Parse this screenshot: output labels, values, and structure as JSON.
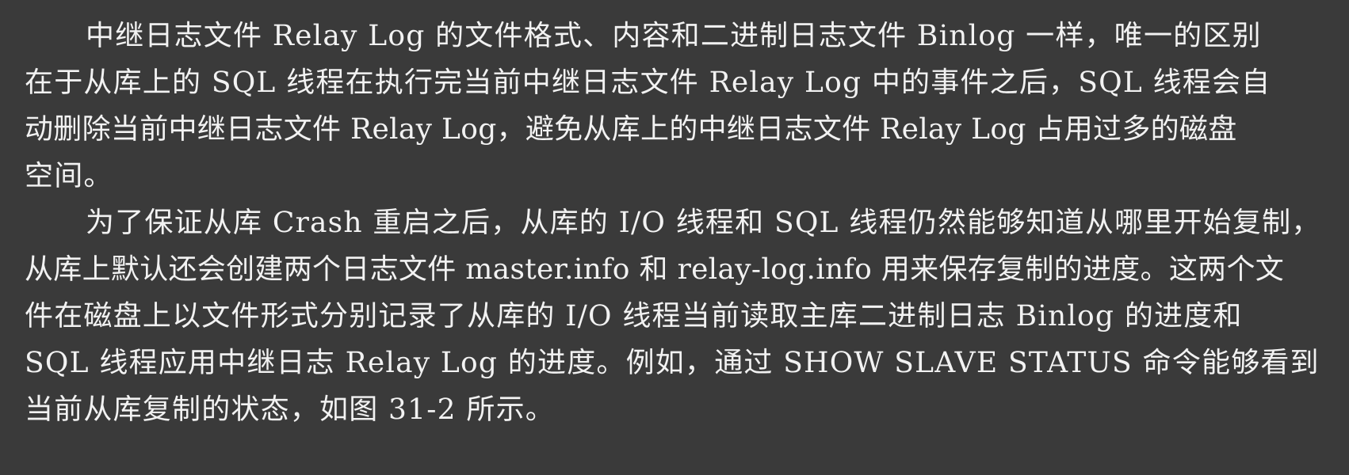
{
  "document": {
    "paragraph_1": {
      "lines": [
        "中继日志文件 Relay Log 的文件格式、内容和二进制日志文件 Binlog 一样，唯一的区别",
        "在于从库上的 SQL 线程在执行完当前中继日志文件 Relay Log 中的事件之后，SQL 线程会自",
        "动删除当前中继日志文件 Relay Log，避免从库上的中继日志文件 Relay Log 占用过多的磁盘",
        "空间。"
      ]
    },
    "paragraph_2": {
      "lines": [
        "为了保证从库 Crash 重启之后，从库的 I/O 线程和 SQL 线程仍然能够知道从哪里开始复制，",
        "从库上默认还会创建两个日志文件 master.info 和 relay-log.info 用来保存复制的进度。这两个文",
        "件在磁盘上以文件形式分别记录了从库的 I/O 线程当前读取主库二进制日志 Binlog 的进度和",
        "SQL 线程应用中继日志 Relay Log 的进度。例如，通过 SHOW SLAVE STATUS 命令能够看到",
        "当前从库复制的状态，如图 31-2 所示。"
      ]
    }
  }
}
